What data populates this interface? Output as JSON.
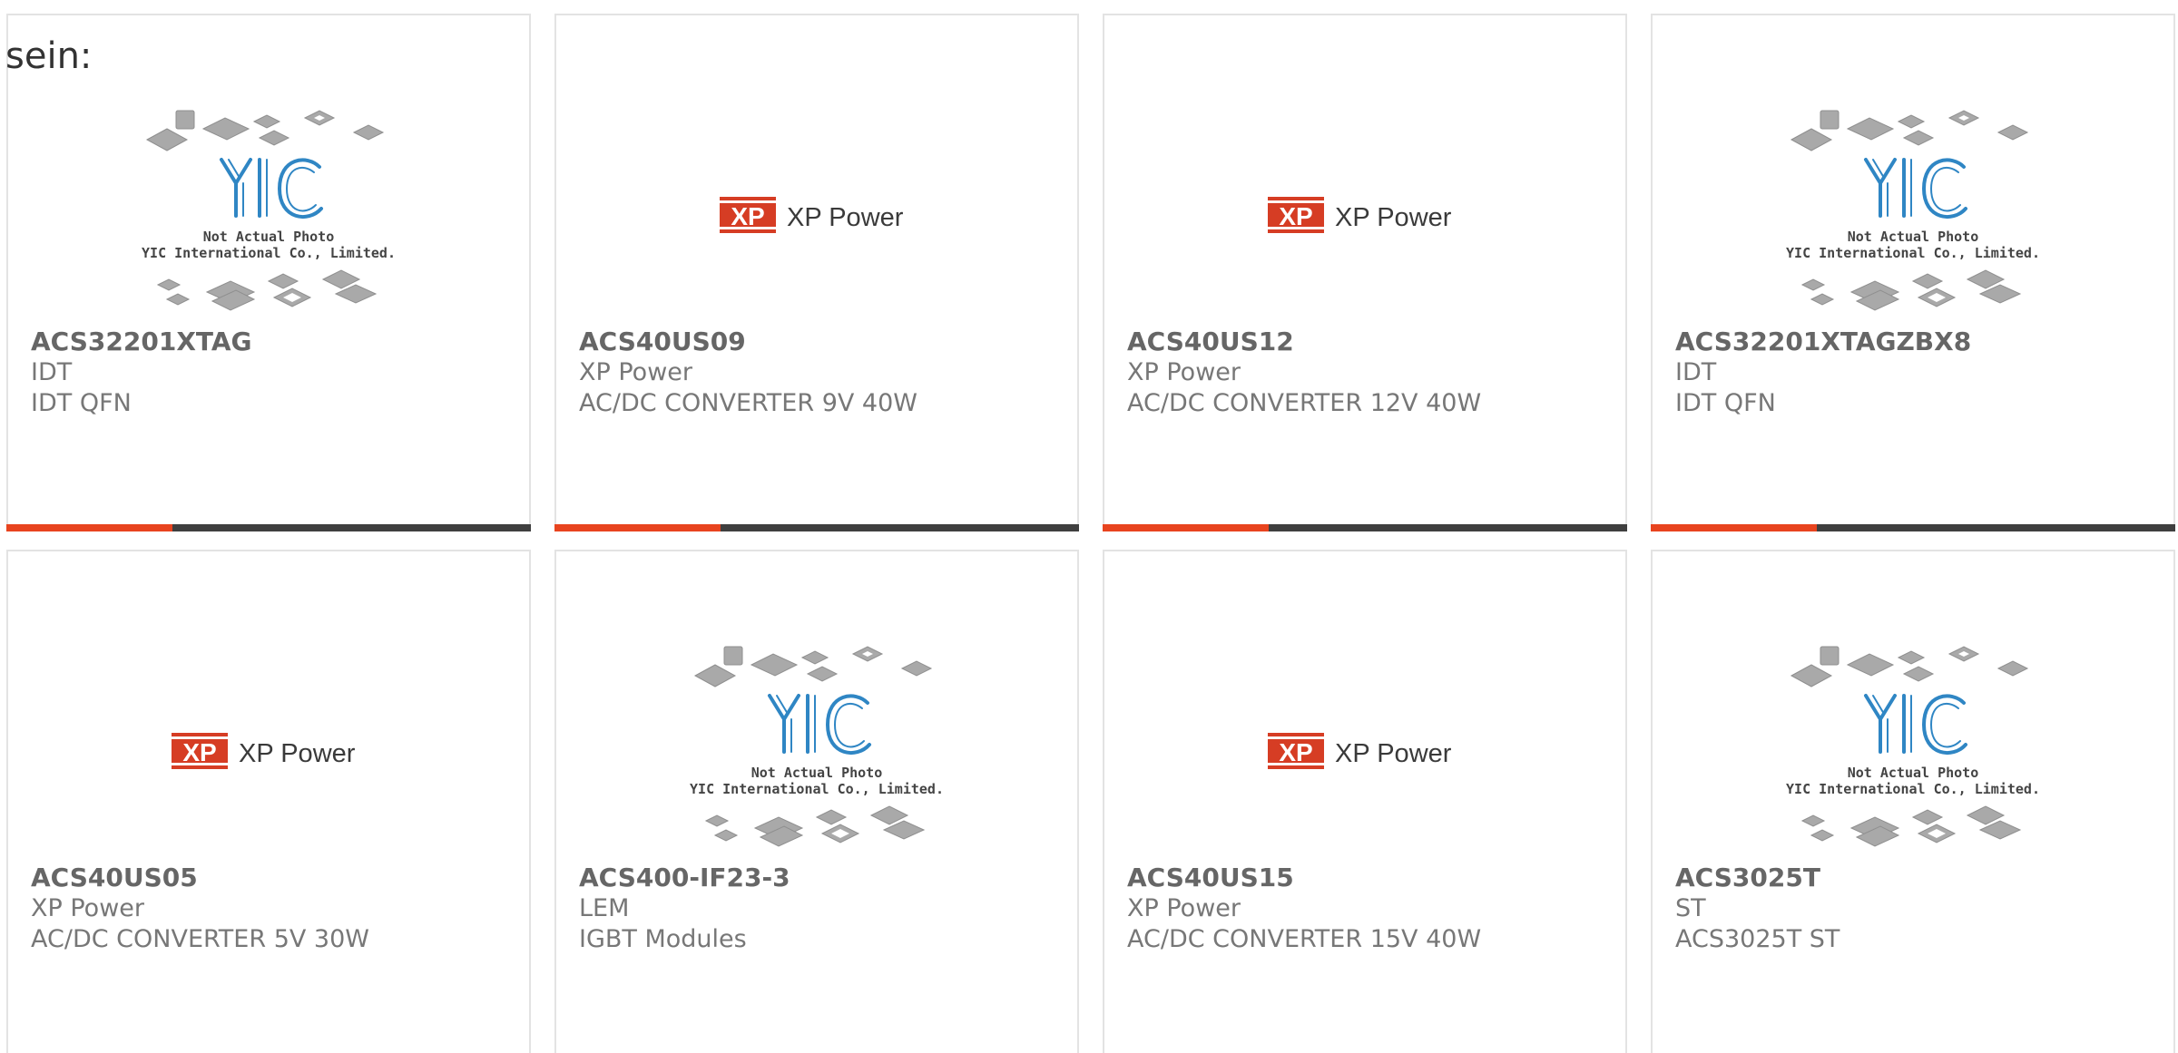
{
  "page": {
    "lead_text": "sein:"
  },
  "colors": {
    "accent": "#e8441f",
    "bar_dark": "#3f3f3f",
    "yic_blue": "#2f86c4",
    "xp_red": "#d63d24"
  },
  "logos": {
    "xp": {
      "badge": "XP",
      "name": "XP Power"
    },
    "yic": {
      "mark": "YIC",
      "line1": "Not Actual Photo",
      "line2": "YIC International Co., Limited."
    }
  },
  "products": [
    {
      "part": "ACS32201XTAG",
      "manufacturer": "IDT",
      "description": "IDT QFN",
      "image_type": "yic-placeholder"
    },
    {
      "part": "ACS40US09",
      "manufacturer": "XP Power",
      "description": "AC/DC CONVERTER 9V 40W",
      "image_type": "xp-power-logo"
    },
    {
      "part": "ACS40US12",
      "manufacturer": "XP Power",
      "description": "AC/DC CONVERTER 12V 40W",
      "image_type": "xp-power-logo"
    },
    {
      "part": "ACS32201XTAGZBX8",
      "manufacturer": "IDT",
      "description": "IDT QFN",
      "image_type": "yic-placeholder"
    },
    {
      "part": "ACS40US05",
      "manufacturer": "XP Power",
      "description": "AC/DC CONVERTER 5V 30W",
      "image_type": "xp-power-logo"
    },
    {
      "part": "ACS400-IF23-3",
      "manufacturer": "LEM",
      "description": "IGBT Modules",
      "image_type": "yic-placeholder"
    },
    {
      "part": "ACS40US15",
      "manufacturer": "XP Power",
      "description": "AC/DC CONVERTER 15V 40W",
      "image_type": "xp-power-logo"
    },
    {
      "part": "ACS3025T",
      "manufacturer": "ST",
      "description": "ACS3025T ST",
      "image_type": "yic-placeholder"
    }
  ]
}
